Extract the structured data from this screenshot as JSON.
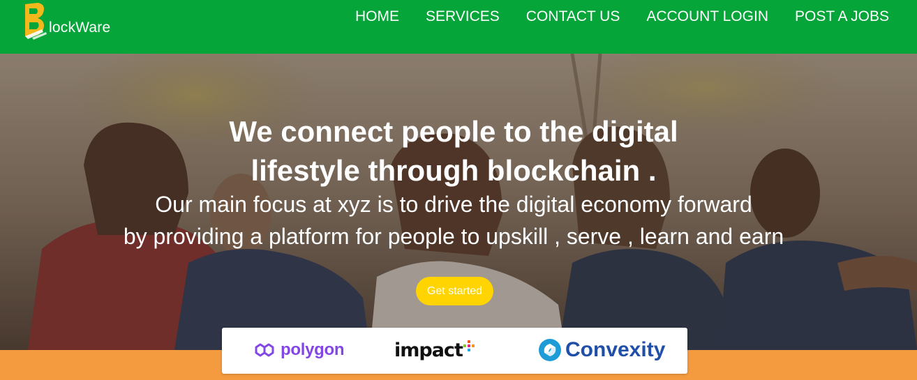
{
  "brand": {
    "name": "lockWare",
    "logo_icon": "blockware-logo-icon"
  },
  "nav": {
    "items": [
      {
        "label": "HOME"
      },
      {
        "label": "SERVICES"
      },
      {
        "label": "CONTACT US"
      },
      {
        "label": "ACCOUNT LOGIN"
      },
      {
        "label": "POST A JOBS"
      }
    ]
  },
  "hero": {
    "headline_line1": "We connect people to the digital",
    "headline_line2": "lifestyle through blockchain .",
    "sub_line1": "Our main focus at xyz is to drive the digital economy forward",
    "sub_line2": "by providing a platform for people to upskill , serve , learn and earn",
    "cta_label": "Get started"
  },
  "partners": [
    {
      "name": "polygon",
      "icon": "polygon-logo-icon"
    },
    {
      "name": "impact",
      "icon": "impact-logo-icon"
    },
    {
      "name": "Convexity",
      "icon": "convexity-logo-icon"
    }
  ],
  "colors": {
    "header": "#06a53a",
    "cta": "#ffd400",
    "band": "#f49a3f",
    "polygon": "#8247e5",
    "convexity": "#1f4fa8"
  }
}
